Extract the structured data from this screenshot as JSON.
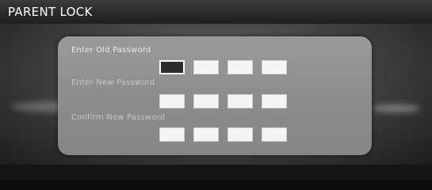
{
  "window": {
    "title": "PARENT LOCK"
  },
  "dialog": {
    "old_password_label": "Enter Old Password",
    "new_password_label": "Enter New Password",
    "confirm_password_label": "Confirm New Password",
    "old_password_digits": [
      "",
      "",
      "",
      ""
    ],
    "new_password_digits": [
      "",
      "",
      "",
      ""
    ],
    "confirm_password_digits": [
      "",
      "",
      "",
      ""
    ],
    "active_field": "old_password",
    "active_digit_index": 0
  }
}
